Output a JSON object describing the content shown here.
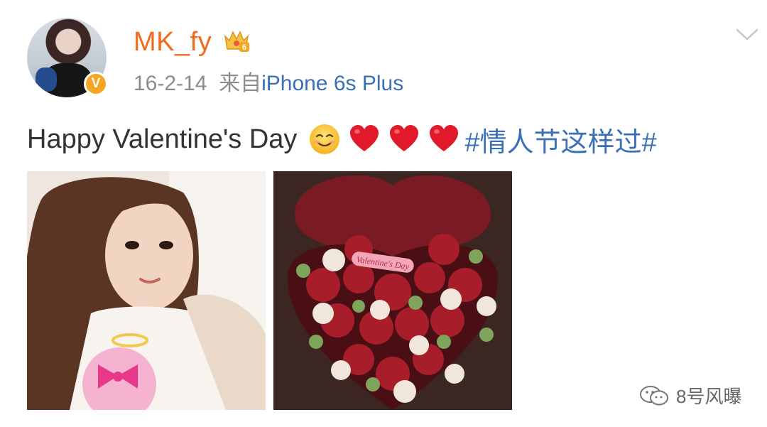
{
  "post": {
    "username": "MK_fy",
    "vip_level": "6",
    "verified_mark": "V",
    "date": "16-2-14",
    "source_prefix": "来自",
    "source_device": "iPhone 6s Plus",
    "text": "Happy Valentine's Day",
    "emojis": [
      "smiling-face-icon",
      "red-heart-icon",
      "red-heart-icon",
      "red-heart-icon"
    ],
    "hashtag": "#情人节这样过#",
    "images": [
      {
        "name": "selfie-photo"
      },
      {
        "name": "rose-box-photo",
        "card_text": "Valentine's Day"
      }
    ]
  },
  "watermark": {
    "text": "8号风曝",
    "icon": "wechat-icon"
  },
  "colors": {
    "username": "#f26b1d",
    "link": "#3b6fb6",
    "meta": "#8c8c8c",
    "body_text": "#333333",
    "verified": "#f5a623"
  }
}
